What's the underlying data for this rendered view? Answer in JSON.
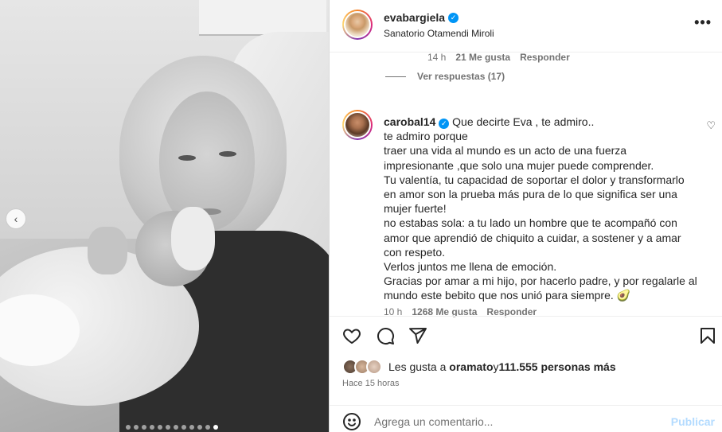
{
  "post": {
    "carousel_prev_icon": "chevron-left-icon",
    "carousel_total": 12,
    "carousel_active_index": 11
  },
  "header": {
    "username": "evabargiela",
    "location": "Sanatorio Otamendi Miroli",
    "more_icon": "more-horizontal-icon",
    "more_label": "•••"
  },
  "prev_comment_meta": {
    "time": "14 h",
    "likes": "21 Me gusta",
    "reply": "Responder",
    "view_replies": "Ver respuestas (17)"
  },
  "comment": {
    "username": "carobal14",
    "lines": [
      "Que decirte Eva , te admiro..",
      "te admiro porque",
      "traer una vida al mundo es un acto de una fuerza impresionante ,que solo una mujer puede comprender.",
      "Tu valentía, tu capacidad de soportar el dolor y transformarlo en amor son la prueba más pura de lo que significa ser una mujer fuerte!",
      "no estabas sola: a tu lado un hombre que te acompañó con amor que aprendió de chiquito a cuidar, a sostener y a amar con respeto.",
      "Verlos juntos me llena de emoción.",
      "Gracias por amar a mi hijo, por hacerlo padre, y por regalarle al mundo este bebito que nos unió para siempre. 🥑"
    ],
    "time": "10 h",
    "likes": "1268 Me gusta",
    "reply": "Responder",
    "like_icon": "heart-outline-icon"
  },
  "actions": {
    "icons": [
      "heart-icon",
      "comment-icon",
      "share-icon",
      "bookmark-icon"
    ]
  },
  "likes": {
    "prefix": "Les gusta a ",
    "user": "oramato",
    "middle": " y ",
    "count": "111.555 personas más"
  },
  "time_ago": "Hace 15 horas",
  "comment_box": {
    "placeholder": "Agrega un comentario...",
    "publish": "Publicar",
    "emoji_icon": "smiley-icon"
  }
}
